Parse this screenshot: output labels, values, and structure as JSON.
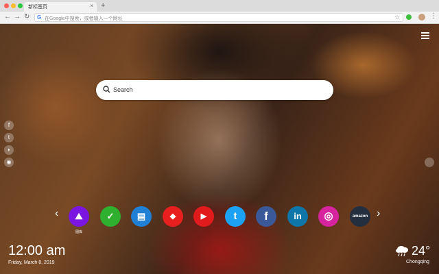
{
  "browser": {
    "tab_title": "新标签页",
    "tab_close": "×",
    "new_tab": "+",
    "omnibox_placeholder": "在Google中搜索，或者输入一个网址",
    "g_icon": "G",
    "nav": {
      "back": "←",
      "forward": "→",
      "reload": "↻"
    },
    "star": "☆",
    "menu": "⋮"
  },
  "search": {
    "placeholder": "Search"
  },
  "sidebar": {
    "left_icons": [
      {
        "name": "facebook-icon",
        "glyph": "f"
      },
      {
        "name": "twitter-icon",
        "glyph": "t"
      },
      {
        "name": "snapchat-icon",
        "glyph": "◗"
      },
      {
        "name": "wechat-icon",
        "glyph": "◉"
      }
    ]
  },
  "shortcuts": {
    "prev": "‹",
    "next": "›",
    "items": [
      {
        "name": "gallery-shortcut",
        "glyph": "⛰",
        "color": "#7b16e0",
        "label": "图库"
      },
      {
        "name": "tasks-shortcut",
        "glyph": "✓",
        "color": "#2fb12f"
      },
      {
        "name": "news-shortcut",
        "glyph": "▤",
        "color": "#1f80d6"
      },
      {
        "name": "games-shortcut",
        "glyph": "◆",
        "color": "#e81f1f"
      },
      {
        "name": "youtube-shortcut",
        "glyph": "▶",
        "color": "#e11b1b"
      },
      {
        "name": "twitter-shortcut",
        "glyph": "t",
        "color": "#1da1f2"
      },
      {
        "name": "facebook-shortcut",
        "glyph": "f",
        "color": "#3b5998"
      },
      {
        "name": "linkedin-shortcut",
        "glyph": "in",
        "color": "#0e76a8"
      },
      {
        "name": "instagram-shortcut",
        "glyph": "◎",
        "color": "#d6249f"
      },
      {
        "name": "amazon-shortcut",
        "glyph": "amazon",
        "color": "#232f3e"
      }
    ]
  },
  "clock": {
    "time": "12:00 am",
    "date": "Friday, March 8, 2019"
  },
  "weather": {
    "temp": "24°",
    "city": "Chongqing",
    "icon": "cloud-rain-icon"
  }
}
